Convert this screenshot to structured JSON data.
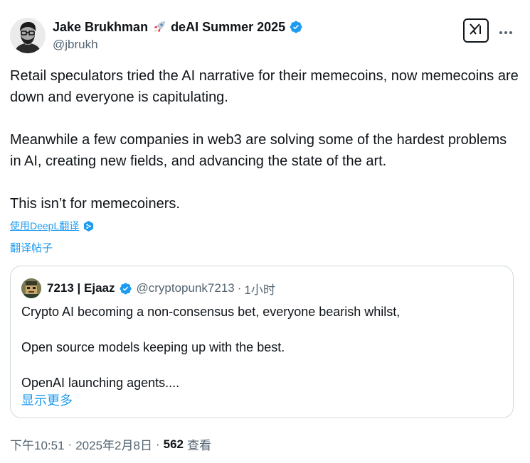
{
  "author": {
    "name": "Jake Brukhman",
    "name_suffix": "deAI Summer 2025",
    "handle": "@jbrukh"
  },
  "tweet": {
    "paragraphs": [
      "Retail speculators tried the AI narrative for their memecoins, now memecoins are down and everyone is capitulating.",
      "Meanwhile a few companies in web3 are solving some of the hardest problems in AI, creating new fields, and advancing the state of the art.",
      "This isn’t for memecoiners."
    ],
    "translate_deepl_label": "使用DeepL翻译",
    "translate_post_label": "翻译帖子"
  },
  "quote": {
    "name": "7213 | Ejaaz",
    "handle": "@cryptopunk7213",
    "separator": "·",
    "time": "1小时",
    "paragraphs": [
      "Crypto AI becoming a non-consensus bet, everyone bearish whilst,",
      "Open source models keeping up with the best.",
      "OpenAI launching agents...."
    ],
    "show_more_label": "显示更多"
  },
  "meta": {
    "time": "下午10:51",
    "separator": "·",
    "date": "2025年2月8日",
    "views_count": "562",
    "views_label": "查看"
  },
  "icons": {
    "verified": "verified-badge-icon",
    "grok": "grok-icon",
    "more": "more-horizontal-icon",
    "deepl": "deepl-icon",
    "rocket": "rocket-emoji-icon"
  },
  "colors": {
    "accent": "#1d9bf0",
    "text": "#0f1419",
    "secondary": "#536471",
    "border": "#cfd9de"
  }
}
